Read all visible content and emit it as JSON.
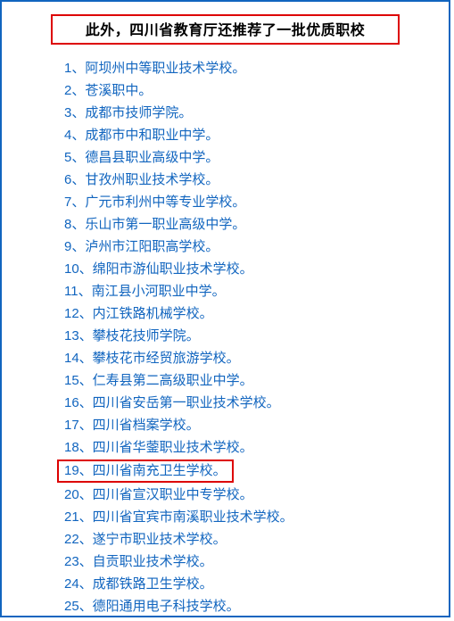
{
  "headline": "此外，四川省教育厅还推荐了一批优质职校",
  "items": [
    "1、阿坝州中等职业技术学校。",
    "2、苍溪职中。",
    "3、成都市技师学院。",
    "4、成都市中和职业中学。",
    "5、德昌县职业高级中学。",
    "6、甘孜州职业技术学校。",
    "7、广元市利州中等专业学校。",
    "8、乐山市第一职业高级中学。",
    "9、泸州市江阳职高学校。",
    "10、绵阳市游仙职业技术学校。",
    "11、南江县小河职业中学。",
    "12、内江铁路机械学校。",
    "13、攀枝花技师学院。",
    "14、攀枝花市经贸旅游学校。",
    "15、仁寿县第二高级职业中学。",
    "16、四川省安岳第一职业技术学校。",
    "17、四川省档案学校。",
    "18、四川省华蓥职业技术学校。",
    "19、四川省南充卫生学校。",
    "20、四川省宣汉职业中专学校。",
    "21、四川省宜宾市南溪职业技术学校。",
    "22、遂宁市职业技术学校。",
    "23、自贡职业技术学校。",
    "24、成都铁路卫生学校。",
    "25、德阳通用电子科技学校。"
  ],
  "highlight_index": 18
}
